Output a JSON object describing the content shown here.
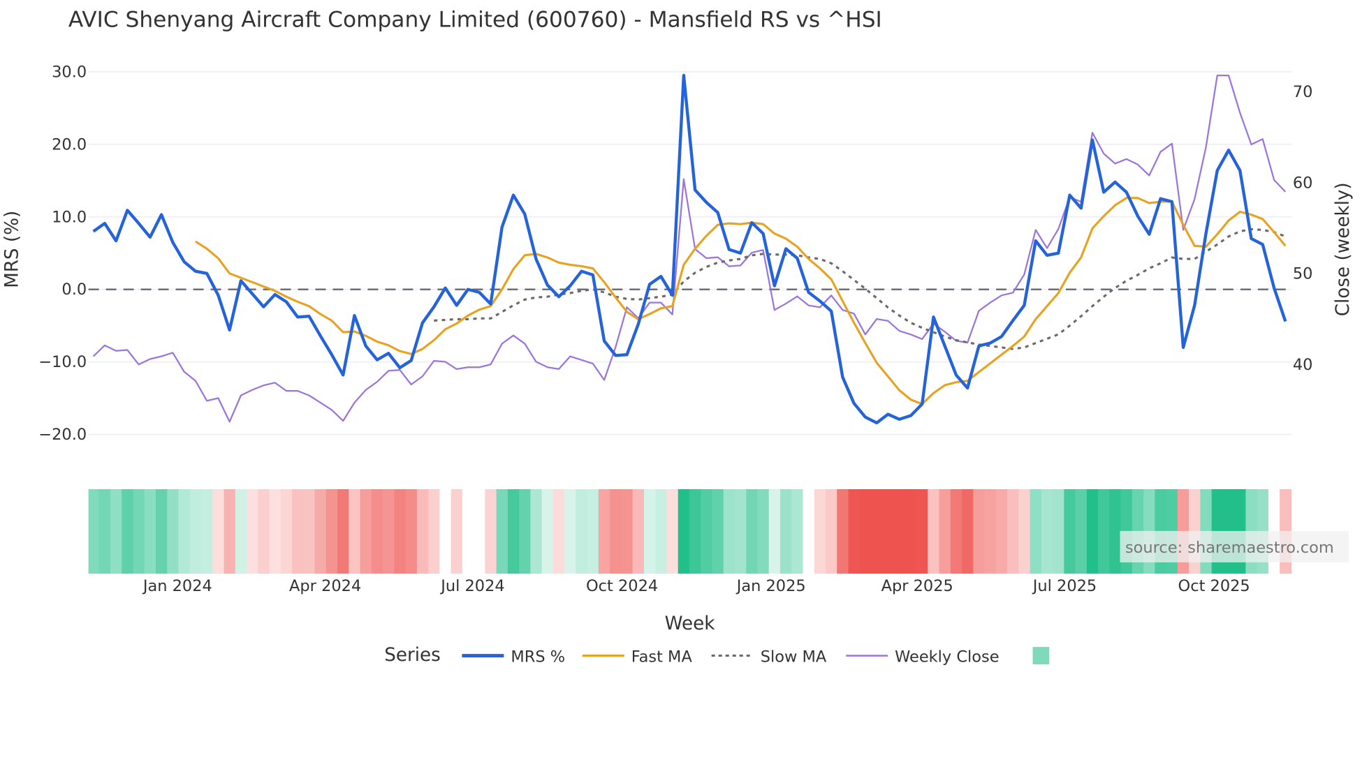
{
  "chart_data": {
    "type": "line",
    "title": "AVIC Shenyang Aircraft Company Limited (600760) - Mansfield RS vs ^HSI",
    "xlabel": "Week",
    "ylabel": "MRS (%)",
    "y2label": "Close (weekly)",
    "x_start": "2023-11-10",
    "x_step_days": 7,
    "xlim": [
      "2023-11-07",
      "2025-11-18"
    ],
    "ylim": [
      -22,
      31
    ],
    "y2lim": [
      30.7,
      73
    ],
    "grid": true,
    "zero_line": 0,
    "x_ticks": [
      {
        "date": "2024-01-01",
        "label": "Jan 2024"
      },
      {
        "date": "2024-04-01",
        "label": "Apr 2024"
      },
      {
        "date": "2024-07-01",
        "label": "Jul 2024"
      },
      {
        "date": "2024-10-01",
        "label": "Oct 2024"
      },
      {
        "date": "2025-01-01",
        "label": "Jan 2025"
      },
      {
        "date": "2025-04-01",
        "label": "Apr 2025"
      },
      {
        "date": "2025-07-01",
        "label": "Jul 2025"
      },
      {
        "date": "2025-10-01",
        "label": "Oct 2025"
      }
    ],
    "y_ticks": [
      {
        "value": 30,
        "label": "30.0"
      },
      {
        "value": 20,
        "label": "20.0"
      },
      {
        "value": 10,
        "label": "10.0"
      },
      {
        "value": 0,
        "label": "0.0"
      },
      {
        "value": -10,
        "label": "−10.0"
      },
      {
        "value": -20,
        "label": "−20.0"
      }
    ],
    "y2_ticks": [
      {
        "value": 40,
        "label": "40"
      },
      {
        "value": 50,
        "label": "50"
      },
      {
        "value": 60,
        "label": "60"
      },
      {
        "value": 70,
        "label": "70"
      }
    ],
    "legend": {
      "title": "Series",
      "placement": "bottom",
      "items": [
        {
          "key": "mrs",
          "label": "MRS %"
        },
        {
          "key": "fast",
          "label": "Fast MA"
        },
        {
          "key": "slow",
          "label": "Slow MA"
        },
        {
          "key": "close",
          "label": "Weekly Close"
        },
        {
          "key": "regime",
          "label": ""
        }
      ]
    },
    "colors": {
      "mrs": "#2563db",
      "fast": "#e8a21f",
      "slow": "#6b6b6b",
      "close": "#9b74e0",
      "positive": "#22bf8a",
      "negative": "#ef5350",
      "zero_line": "#6e6e78",
      "grid": "#eef0f4"
    },
    "series": [
      {
        "key": "mrs",
        "name": "MRS %",
        "axis": "left",
        "start_index": 0,
        "values": [
          8.0,
          9.1,
          6.7,
          10.9,
          9.1,
          7.2,
          10.3,
          6.5,
          3.8,
          2.5,
          2.2,
          -0.8,
          -5.6,
          1.2,
          -0.6,
          -2.4,
          -0.7,
          -1.7,
          -3.8,
          -3.7,
          -6.4,
          -9.0,
          -11.8,
          -3.6,
          -7.8,
          -9.7,
          -8.8,
          -10.8,
          -9.8,
          -4.6,
          -2.4,
          0.2,
          -2.2,
          0.0,
          -0.4,
          -2.0,
          8.6,
          13.0,
          10.4,
          4.2,
          0.6,
          -1.0,
          0.5,
          2.5,
          2.0,
          -7.1,
          -9.1,
          -9.0,
          -4.8,
          0.7,
          1.8,
          -0.8,
          29.5,
          13.7,
          12.0,
          10.6,
          5.5,
          5.0,
          9.2,
          7.7,
          0.5,
          5.6,
          4.3,
          -0.4,
          -1.6,
          -3.0,
          -12.1,
          -15.7,
          -17.6,
          -18.4,
          -17.2,
          -17.9,
          -17.4,
          -15.8,
          -3.8,
          -7.8,
          -11.8,
          -13.6,
          -7.8,
          -7.4,
          -6.5,
          -4.3,
          -2.2,
          6.7,
          4.7,
          5.0,
          13.0,
          11.2,
          20.6,
          13.4,
          14.8,
          13.4,
          10.1,
          7.6,
          12.5,
          12.1,
          -8.0,
          -2.2,
          7.7,
          16.4,
          19.2,
          16.4,
          7.0,
          6.2,
          0.2,
          -4.4
        ]
      },
      {
        "key": "fast",
        "name": "Fast MA",
        "axis": "left",
        "start_index": 9,
        "values": [
          6.6,
          5.6,
          4.3,
          2.2,
          1.6,
          1.0,
          0.4,
          -0.2,
          -1.0,
          -1.7,
          -2.3,
          -3.4,
          -4.3,
          -5.9,
          -5.8,
          -6.4,
          -7.2,
          -7.7,
          -8.5,
          -8.9,
          -8.2,
          -7.0,
          -5.5,
          -4.7,
          -3.6,
          -2.8,
          -2.3,
          0.0,
          2.8,
          4.7,
          4.9,
          4.4,
          3.7,
          3.4,
          3.2,
          2.9,
          1.0,
          -1.1,
          -3.1,
          -4.1,
          -3.4,
          -2.6,
          -2.3,
          3.4,
          5.6,
          7.4,
          8.9,
          9.1,
          9.0,
          9.2,
          9.0,
          7.7,
          7.0,
          5.9,
          4.2,
          2.9,
          1.4,
          -1.6,
          -4.6,
          -7.4,
          -10.1,
          -12.0,
          -13.9,
          -15.2,
          -15.8,
          -14.3,
          -13.2,
          -12.8,
          -12.6,
          -11.4,
          -10.2,
          -9.0,
          -7.8,
          -6.5,
          -4.1,
          -2.3,
          -0.5,
          2.3,
          4.4,
          8.4,
          10.1,
          11.6,
          12.6,
          12.6,
          11.9,
          12.1,
          12.1,
          8.9,
          6.0,
          5.9,
          7.6,
          9.5,
          10.7,
          10.3,
          9.7,
          7.9,
          6.0
        ]
      },
      {
        "key": "slow",
        "name": "Slow MA",
        "axis": "left",
        "start_index": 30,
        "values": [
          -4.3,
          -4.2,
          -4.1,
          -4.1,
          -4.0,
          -4.0,
          -3.1,
          -2.2,
          -1.4,
          -1.1,
          -1.0,
          -0.7,
          -0.5,
          -0.2,
          0.0,
          -0.4,
          -1.0,
          -1.3,
          -1.4,
          -1.2,
          -1.0,
          -0.7,
          1.1,
          2.3,
          3.1,
          3.7,
          4.0,
          4.2,
          4.7,
          4.9,
          4.8,
          4.8,
          4.7,
          4.4,
          4.2,
          3.6,
          2.5,
          1.3,
          0.1,
          -1.2,
          -2.5,
          -3.6,
          -4.6,
          -5.3,
          -5.9,
          -6.5,
          -7.0,
          -7.3,
          -7.6,
          -7.8,
          -8.0,
          -8.2,
          -8.0,
          -7.4,
          -6.8,
          -6.2,
          -5.0,
          -3.7,
          -2.3,
          -1.0,
          0.2,
          1.2,
          2.0,
          2.9,
          3.6,
          4.4,
          4.2,
          4.2,
          5.2,
          6.2,
          7.3,
          8.0,
          8.3,
          8.2,
          7.9,
          7.3
        ]
      },
      {
        "key": "close",
        "name": "Weekly Close",
        "axis": "right",
        "start_index": 0,
        "values": [
          40.9,
          42.1,
          41.5,
          41.6,
          40.0,
          40.6,
          40.9,
          41.3,
          39.2,
          38.2,
          36.0,
          36.3,
          33.7,
          36.6,
          37.2,
          37.7,
          38.0,
          37.1,
          37.1,
          36.6,
          35.8,
          35.0,
          33.8,
          35.8,
          37.2,
          38.1,
          39.3,
          39.4,
          37.8,
          38.7,
          40.4,
          40.3,
          39.5,
          39.7,
          39.7,
          40.0,
          42.3,
          43.2,
          42.3,
          40.3,
          39.7,
          39.5,
          40.9,
          40.5,
          40.1,
          38.3,
          41.9,
          46.3,
          45.1,
          46.8,
          46.8,
          45.5,
          60.4,
          52.7,
          51.7,
          51.8,
          50.8,
          50.9,
          52.3,
          52.6,
          46.0,
          46.7,
          47.5,
          46.5,
          46.3,
          47.6,
          46.0,
          45.6,
          43.3,
          45.0,
          44.8,
          43.7,
          43.3,
          42.8,
          44.5,
          43.6,
          42.6,
          42.4,
          45.9,
          46.8,
          47.6,
          47.9,
          49.9,
          54.8,
          52.8,
          54.9,
          58.4,
          57.9,
          65.5,
          63.2,
          62.1,
          62.6,
          62.0,
          60.8,
          63.4,
          64.3,
          54.8,
          58.2,
          63.9,
          71.8,
          71.8,
          67.7,
          64.2,
          64.8,
          60.3,
          59.0
        ]
      }
    ]
  },
  "source_label": "source: sharemaestro.com"
}
